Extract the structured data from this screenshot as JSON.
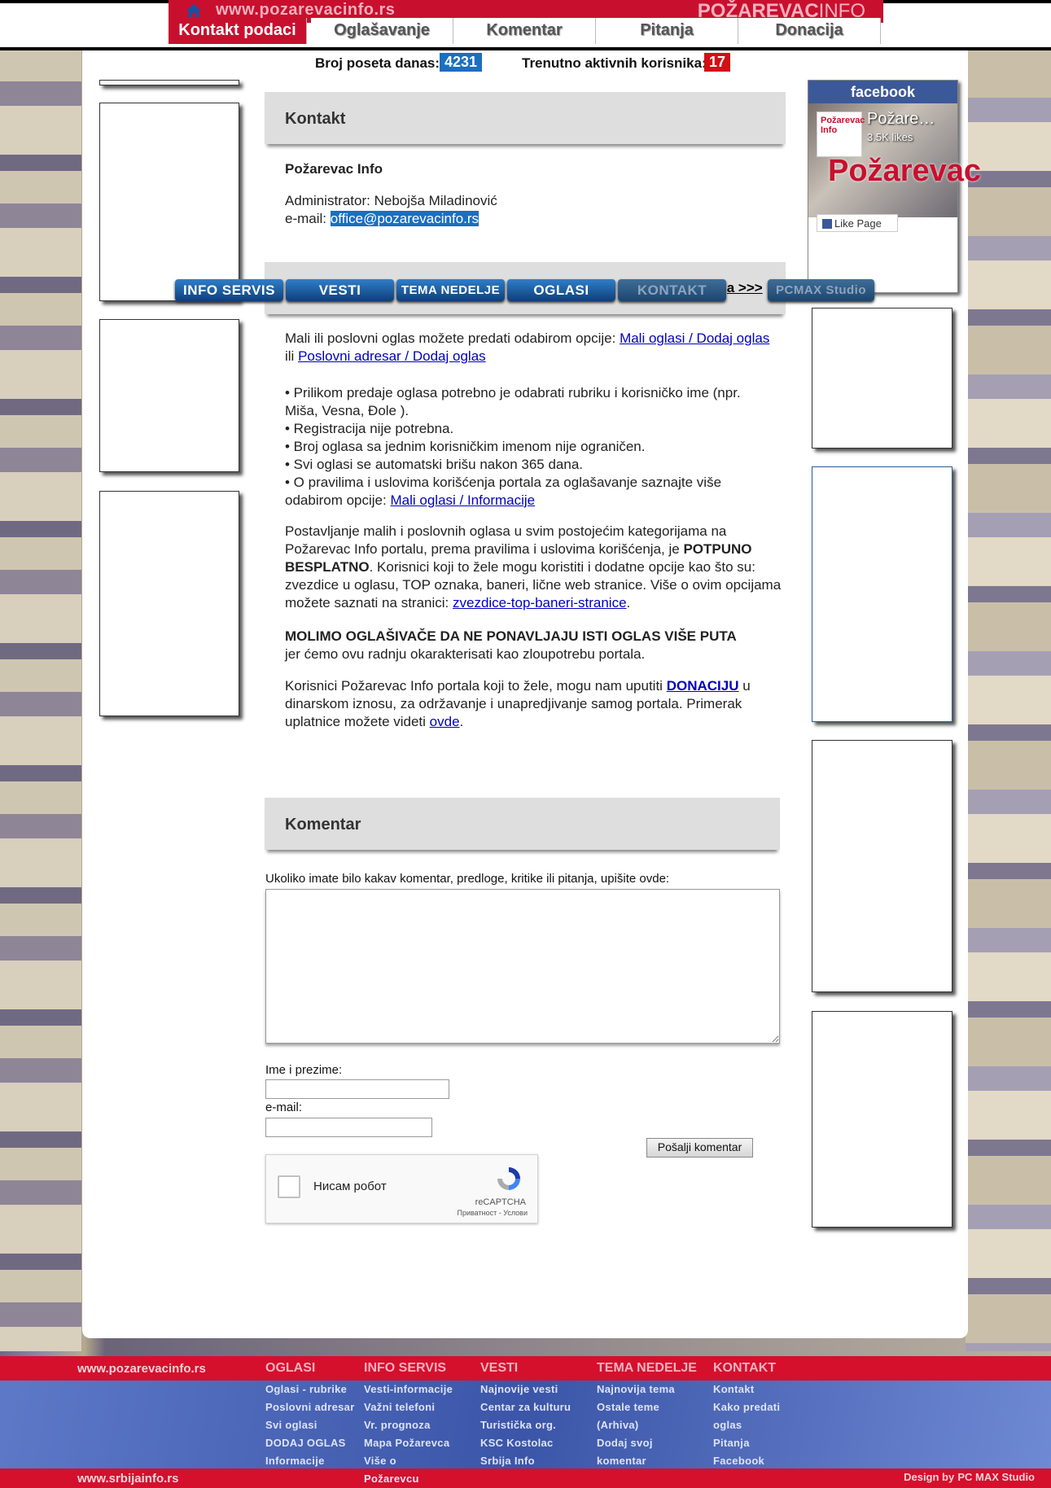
{
  "header": {
    "site_url": "www.pozarevacinfo.rs",
    "brand_bold": "POŽAREVAC",
    "brand_light": "INFO",
    "tabs": [
      {
        "label": "Kontakt podaci",
        "active": true
      },
      {
        "label": "Oglašavanje",
        "active": false
      },
      {
        "label": "Komentar",
        "active": false
      },
      {
        "label": "Pitanja",
        "active": false
      },
      {
        "label": "Donacija",
        "active": false
      }
    ]
  },
  "stats": {
    "visits_label": "Broj poseta danas:",
    "visits_value": "4231",
    "active_label": "Trenutno aktivnih korisnika:",
    "active_value": "17"
  },
  "nav_buttons": [
    "INFO SERVIS",
    "VESTI",
    "TEMA NEDELJE",
    "OGLASI",
    "KONTAKT",
    "PCMAX Studio"
  ],
  "nav_overlap_text": "ja >>>",
  "kontakt": {
    "heading": "Kontakt",
    "org": "Požarevac Info",
    "admin": "Administrator: Nebojša Miladinović",
    "email_label": "e-mail:",
    "email": "office@pozarevacinfo.rs"
  },
  "oglasi": {
    "intro_text": "Mali ili poslovni oglas možete predati odabirom opcije:",
    "link1": "Mali oglasi / Dodaj oglas",
    "or": "ili",
    "link2": "Poslovni adresar / Dodaj oglas",
    "bullets": [
      "• Prilikom predaje oglasa potrebno je odabrati rubriku i korisničko ime (npr. Miša, Vesna, Đole ).",
      "• Registracija nije potrebna.",
      "• Broj oglasa sa jednim korisničkim imenom nije ograničen.",
      "• Svi oglasi se automatski brišu nakon 365 dana."
    ],
    "rules_text": "• O pravilima i uslovima korišćenja portala za oglašavanje saznajte više odabirom opcije:",
    "rules_link": "Mali oglasi / Informacije",
    "para1_start": "Postavljanje malih i poslovnih oglasa u svim postojećim kategorijama na Požarevac Info portalu, prema pravilima i uslovima korišćenja, je",
    "para1_bold": "POTPUNO BESPLATNO",
    "para1_rest": ". Korisnici koji to žele mogu koristiti i dodatne opcije kao što su: zvezdice u oglasu, TOP oznaka, baneri, lične web stranice. Više o ovim opcijama možete saznati na stranici:",
    "para1_link": "zvezdice-top-baneri-stranice",
    "warning_bold": "MOLIMO OGLAŠIVAČE DA NE PONAVLJAJU ISTI OGLAS VIŠE PUTA",
    "warning_rest": "jer ćemo ovu radnju okarakterisati kao zloupotrebu portala.",
    "donation_start": "Korisnici Požarevac Info portala koji to žele, mogu nam uputiti",
    "donation_link": "DONACIJU",
    "donation_rest": "u dinarskom iznosu, za održavanje i unapredjivanje samog portala. Primerak uplatnice možete videti",
    "donation_link2": "ovde"
  },
  "komentar": {
    "heading": "Komentar",
    "prompt": "Ukoliko imate bilo kakav komentar, predloge, kritike ili pitanja, upišite ovde:",
    "comment_value": "",
    "name_label": "Ime i prezime:",
    "name_value": "",
    "email_label": "e-mail:",
    "email_value": "",
    "submit_label": "Pošalji komentar",
    "captcha_label": "Нисам робот",
    "captcha_brand": "reCAPTCHA",
    "captcha_links": "Приватност - Услови"
  },
  "facebook": {
    "header": "facebook",
    "page_name": "Požare…",
    "likes": "3.5K likes",
    "logo_text": "Požarevac Info",
    "cover_text": "Požarevac",
    "like_button": "Like Page"
  },
  "footer": {
    "site": "www.pozarevacinfo.rs",
    "site2": "www.srbijainfo.rs",
    "design_label": "Design by",
    "design_name": "PC MAX Studio",
    "columns": [
      {
        "title": "OGLASI",
        "items": [
          "Oglasi - rubrike",
          "Poslovni adresar",
          "Svi oglasi",
          "DODAJ OGLAS",
          "Informacije"
        ]
      },
      {
        "title": "INFO SERVIS",
        "items": [
          "Vesti-informacije",
          "Važni telefoni",
          "Vr. prognoza",
          "Mapa Požarevca",
          "Više o",
          "Požarevcu"
        ]
      },
      {
        "title": "VESTI",
        "items": [
          "Najnovije vesti",
          "Centar za kulturu",
          "Turistička org.",
          "KSC Kostolac",
          "Srbija Info"
        ]
      },
      {
        "title": "TEMA NEDELJE",
        "items": [
          "Najnovija tema",
          "Ostale teme",
          "(Arhiva)",
          "Dodaj svoj",
          "komentar"
        ]
      },
      {
        "title": "KONTAKT",
        "items": [
          "Kontakt",
          "Kako predati",
          "oglas",
          "Pitanja",
          "Facebook"
        ]
      }
    ]
  },
  "colors": {
    "brand_red": "#c8102e",
    "nav_blue": "#1a6fc0",
    "link": "#0000c0",
    "email_highlight": "#1a6fc0"
  }
}
